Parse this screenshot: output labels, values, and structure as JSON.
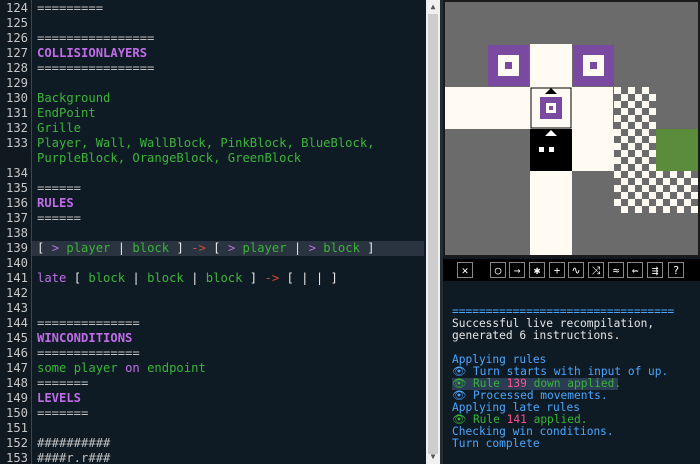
{
  "editor": {
    "lines": [
      {
        "n": "124",
        "segs": [
          {
            "t": "=========",
            "c": "c-comment"
          }
        ]
      },
      {
        "n": "125",
        "segs": []
      },
      {
        "n": "126",
        "segs": [
          {
            "t": "================",
            "c": "c-comment"
          }
        ]
      },
      {
        "n": "127",
        "segs": [
          {
            "t": "COLLISIONLAYERS",
            "c": "c-head"
          }
        ]
      },
      {
        "n": "128",
        "segs": [
          {
            "t": "================",
            "c": "c-comment"
          }
        ]
      },
      {
        "n": "129",
        "segs": []
      },
      {
        "n": "130",
        "segs": [
          {
            "t": "Background",
            "c": "c-green"
          }
        ]
      },
      {
        "n": "131",
        "segs": [
          {
            "t": "EndPoint",
            "c": "c-green"
          }
        ]
      },
      {
        "n": "132",
        "segs": [
          {
            "t": "Grille",
            "c": "c-green"
          }
        ]
      },
      {
        "n": "133",
        "segs": [
          {
            "t": "Player, Wall, WallBlock, PinkBlock, BlueBlock,",
            "c": "c-green"
          }
        ]
      },
      {
        "n": "",
        "segs": [
          {
            "t": "PurpleBlock, OrangeBlock, GreenBlock",
            "c": "c-green"
          }
        ]
      },
      {
        "n": "134",
        "segs": []
      },
      {
        "n": "135",
        "segs": [
          {
            "t": "======",
            "c": "c-comment"
          }
        ]
      },
      {
        "n": "136",
        "segs": [
          {
            "t": "RULES",
            "c": "c-head"
          }
        ]
      },
      {
        "n": "137",
        "segs": [
          {
            "t": "======",
            "c": "c-comment"
          }
        ]
      },
      {
        "n": "138",
        "segs": []
      },
      {
        "n": "139",
        "hl": true,
        "segs": [
          {
            "t": "[ ",
            "c": "c-white"
          },
          {
            "t": ">",
            "c": "c-purple"
          },
          {
            "t": " player ",
            "c": "c-green"
          },
          {
            "t": "|",
            "c": "c-white"
          },
          {
            "t": " block ",
            "c": "c-green"
          },
          {
            "t": "] ",
            "c": "c-white"
          },
          {
            "t": "->",
            "c": "c-red"
          },
          {
            "t": " [ ",
            "c": "c-white"
          },
          {
            "t": ">",
            "c": "c-purple"
          },
          {
            "t": " player ",
            "c": "c-green"
          },
          {
            "t": "|",
            "c": "c-white"
          },
          {
            "t": " ",
            "c": "c-white"
          },
          {
            "t": ">",
            "c": "c-purple"
          },
          {
            "t": " block ",
            "c": "c-green"
          },
          {
            "t": "]",
            "c": "c-white"
          }
        ]
      },
      {
        "n": "140",
        "segs": []
      },
      {
        "n": "141",
        "segs": [
          {
            "t": "late",
            "c": "c-purple"
          },
          {
            "t": " [ ",
            "c": "c-white"
          },
          {
            "t": "block",
            "c": "c-green"
          },
          {
            "t": " | ",
            "c": "c-white"
          },
          {
            "t": "block",
            "c": "c-green"
          },
          {
            "t": " | ",
            "c": "c-white"
          },
          {
            "t": "block",
            "c": "c-green"
          },
          {
            "t": " ] ",
            "c": "c-white"
          },
          {
            "t": "->",
            "c": "c-red"
          },
          {
            "t": " [ | | ]",
            "c": "c-white"
          }
        ]
      },
      {
        "n": "142",
        "segs": []
      },
      {
        "n": "143",
        "segs": []
      },
      {
        "n": "144",
        "segs": [
          {
            "t": "==============",
            "c": "c-comment"
          }
        ]
      },
      {
        "n": "145",
        "segs": [
          {
            "t": "WINCONDITIONS",
            "c": "c-head"
          }
        ]
      },
      {
        "n": "146",
        "segs": [
          {
            "t": "==============",
            "c": "c-comment"
          }
        ]
      },
      {
        "n": "147",
        "segs": [
          {
            "t": "some",
            "c": "c-green"
          },
          {
            "t": " player ",
            "c": "c-green"
          },
          {
            "t": "on",
            "c": "c-purple"
          },
          {
            "t": " endpoint",
            "c": "c-green"
          }
        ]
      },
      {
        "n": "148",
        "segs": [
          {
            "t": "=======",
            "c": "c-comment"
          }
        ]
      },
      {
        "n": "149",
        "segs": [
          {
            "t": "LEVELS",
            "c": "c-head"
          }
        ]
      },
      {
        "n": "150",
        "segs": [
          {
            "t": "=======",
            "c": "c-comment"
          }
        ]
      },
      {
        "n": "151",
        "segs": []
      },
      {
        "n": "152",
        "segs": [
          {
            "t": "##########",
            "c": "c-comment"
          }
        ]
      },
      {
        "n": "153",
        "segs": [
          {
            "t": "####r.r###",
            "c": "c-comment"
          }
        ]
      }
    ]
  },
  "toolbar": {
    "buttons": [
      {
        "name": "close-icon",
        "glyph": "✕"
      },
      {
        "name": "circle-tool-icon",
        "glyph": "○"
      },
      {
        "name": "arrow-tool-icon",
        "glyph": "→"
      },
      {
        "name": "star-tool-icon",
        "glyph": "✱"
      },
      {
        "name": "plus-tool-icon",
        "glyph": "+"
      },
      {
        "name": "tilde-tool-icon",
        "glyph": "∿"
      },
      {
        "name": "cross-tool-icon",
        "glyph": "⤨"
      },
      {
        "name": "wave-tool-icon",
        "glyph": "≈"
      },
      {
        "name": "undo-tool-icon",
        "glyph": "⇜"
      },
      {
        "name": "list-tool-icon",
        "glyph": "⇶"
      },
      {
        "name": "help-icon",
        "glyph": "?"
      }
    ]
  },
  "console": {
    "separator": "=================================",
    "lines": [
      {
        "segs": [
          {
            "t": "Successful live recompilation,",
            "c": ""
          }
        ]
      },
      {
        "segs": [
          {
            "t": "generated 6 instructions.",
            "c": ""
          }
        ]
      },
      {
        "segs": []
      },
      {
        "segs": [
          {
            "t": "Applying rules",
            "c": "blue"
          }
        ]
      },
      {
        "segs": [
          {
            "t": "👁 Turn starts with input of up.",
            "c": "blue"
          }
        ]
      },
      {
        "hl": true,
        "segs": [
          {
            "t": "👁 Rule ",
            "c": "green2"
          },
          {
            "t": "139",
            "c": "pink"
          },
          {
            "t": " down applied.",
            "c": "green2"
          }
        ]
      },
      {
        "segs": [
          {
            "t": "👁 Processed movements.",
            "c": "blue"
          }
        ]
      },
      {
        "segs": [
          {
            "t": "Applying late rules",
            "c": "blue"
          }
        ]
      },
      {
        "segs": [
          {
            "t": "👁 Rule ",
            "c": "green2"
          },
          {
            "t": "141",
            "c": "pink"
          },
          {
            "t": " applied.",
            "c": "green2"
          }
        ]
      },
      {
        "segs": [
          {
            "t": "Checking win conditions.",
            "c": "blue"
          }
        ]
      },
      {
        "segs": [
          {
            "t": "Turn complete",
            "c": "blue"
          }
        ]
      }
    ]
  },
  "game": {
    "bg_color": "#6b6b6b",
    "floor_color": "#fffaf2",
    "purple_color": "#7a4aa0",
    "green_color": "#5a8c3c",
    "player_color": "#000000"
  }
}
